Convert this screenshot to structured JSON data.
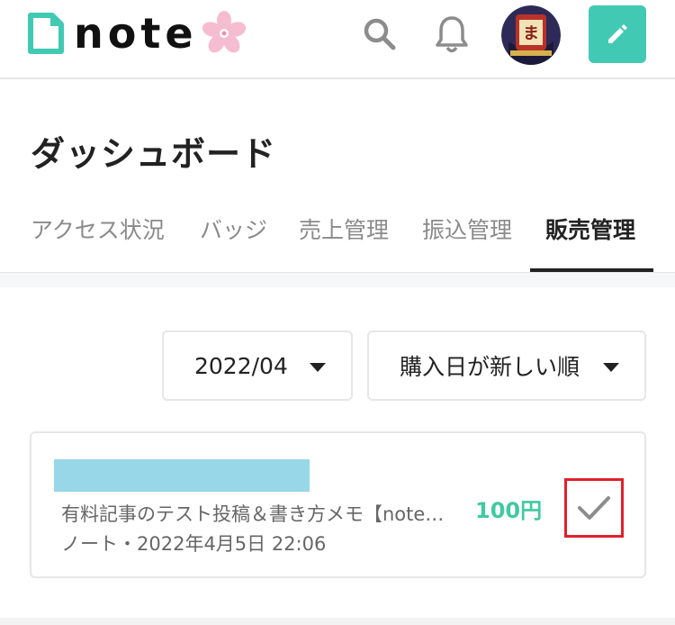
{
  "header": {
    "logo_text": "note",
    "icons": [
      "search-icon",
      "bell-icon",
      "avatar",
      "pencil-icon"
    ],
    "brand_color": "#41c9b4"
  },
  "page": {
    "title": "ダッシュボード"
  },
  "tabs": [
    {
      "label": "アクセス状況",
      "active": false
    },
    {
      "label": "バッジ",
      "active": false
    },
    {
      "label": "売上管理",
      "active": false
    },
    {
      "label": "振込管理",
      "active": false
    },
    {
      "label": "販売管理",
      "active": true
    }
  ],
  "filters": {
    "month": "2022/04",
    "sort": "購入日が新しい順"
  },
  "sales": [
    {
      "title": "有料記事のテスト投稿＆書き方メモ【note…",
      "meta": "ノート・2022年4月5日 22:06",
      "price": "100円",
      "checked": true
    }
  ],
  "colors": {
    "price": "#41c9a0",
    "highlight": "#e0202b",
    "redaction": "#97d7e8"
  }
}
